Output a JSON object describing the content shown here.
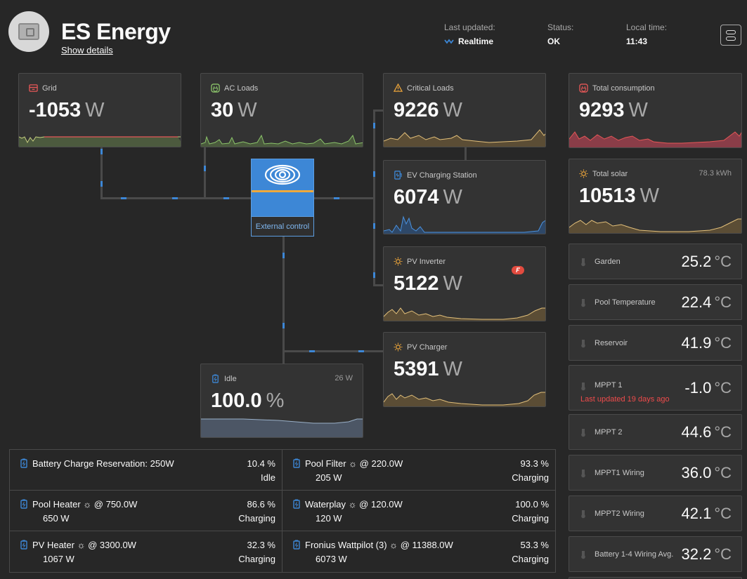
{
  "header": {
    "title": "ES Energy",
    "show_details": "Show details",
    "last_updated_label": "Last updated:",
    "last_updated_value": "Realtime",
    "status_label": "Status:",
    "status_value": "OK",
    "local_time_label": "Local time:",
    "local_time_value": "11:43"
  },
  "tiles": {
    "grid": {
      "title": "Grid",
      "value": "-1053",
      "unit": "W"
    },
    "ac_loads": {
      "title": "AC Loads",
      "value": "30",
      "unit": "W"
    },
    "critical_loads": {
      "title": "Critical Loads",
      "value": "9226",
      "unit": "W"
    },
    "ev_charging": {
      "title": "EV Charging Station",
      "value": "6074",
      "unit": "W"
    },
    "pv_inverter": {
      "title": "PV Inverter",
      "value": "5122",
      "unit": "W"
    },
    "pv_charger": {
      "title": "PV Charger",
      "value": "5391",
      "unit": "W"
    },
    "battery": {
      "title": "Idle",
      "extra": "26 W",
      "value": "100.0",
      "unit": "%"
    },
    "total_consumption": {
      "title": "Total consumption",
      "value": "9293",
      "unit": "W"
    },
    "total_solar": {
      "title": "Total solar",
      "extra": "78.3 kWh",
      "value": "10513",
      "unit": "W"
    }
  },
  "inverter": {
    "label": "External control"
  },
  "temperatures": [
    {
      "name": "Garden",
      "value": "25.2",
      "unit": "°C"
    },
    {
      "name": "Pool Temperature",
      "value": "22.4",
      "unit": "°C"
    },
    {
      "name": "Reservoir",
      "value": "41.9",
      "unit": "°C"
    },
    {
      "name": "MPPT 1",
      "value": "-1.0",
      "unit": "°C",
      "warning": "Last updated 19 days ago"
    },
    {
      "name": "MPPT 2",
      "value": "44.6",
      "unit": "°C"
    },
    {
      "name": "MPPT1 Wiring",
      "value": "36.0",
      "unit": "°C"
    },
    {
      "name": "MPPT2 Wiring",
      "value": "42.1",
      "unit": "°C"
    },
    {
      "name": "Battery 1-4 Wiring Avg.",
      "value": "32.2",
      "unit": "°C"
    }
  ],
  "chargers": [
    {
      "name": "Battery Charge Reservation: 250W",
      "sub": "",
      "pct": "10.4 %",
      "state": "Idle"
    },
    {
      "name": "Pool Filter ☼ @ 220.0W",
      "sub": "205 W",
      "pct": "93.3 %",
      "state": "Charging"
    },
    {
      "name": "Pool Heater ☼ @ 750.0W",
      "sub": "650 W",
      "pct": "86.6 %",
      "state": "Charging"
    },
    {
      "name": "Waterplay ☼ @ 120.0W",
      "sub": "120 W",
      "pct": "100.0 %",
      "state": "Charging"
    },
    {
      "name": "PV Heater ☼ @ 3300.0W",
      "sub": "1067 W",
      "pct": "32.3 %",
      "state": "Charging"
    },
    {
      "name": "Fronius Wattpilot (3) ☼ @ 11388.0W",
      "sub": "6073 W",
      "pct": "53.3 %",
      "state": "Charging"
    }
  ],
  "icons": {
    "grid": "grid-icon",
    "ac_loads": "ac-loads-icon",
    "critical_loads": "warning-icon",
    "ev": "ev-charger-icon",
    "solar": "sun-icon",
    "battery": "battery-icon",
    "consumption": "consumption-icon",
    "temperature": "thermometer-icon",
    "fronius": "fronius-logo"
  },
  "colors": {
    "background": "#272727",
    "tile": "#333333",
    "accent_blue": "#3d87d6",
    "grid": "#e65757",
    "ac_loads": "#8bc36a",
    "solar": "#e8a23a",
    "warning": "#ee4b4b"
  }
}
